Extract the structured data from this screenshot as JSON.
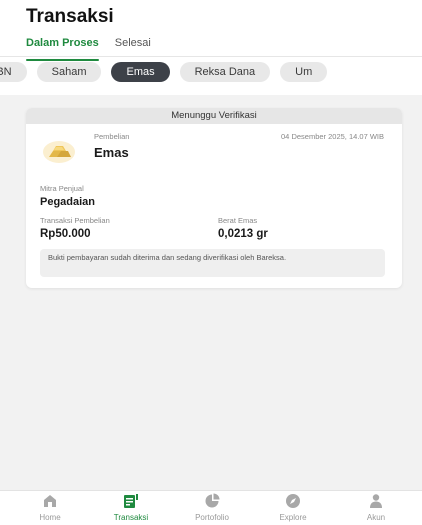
{
  "header": {
    "title": "Transaksi",
    "status_tabs": [
      {
        "label": "Dalam Proses",
        "active": true
      },
      {
        "label": "Selesai",
        "active": false
      }
    ],
    "category_chips": [
      {
        "label": "SBN",
        "active": false
      },
      {
        "label": "Saham",
        "active": false
      },
      {
        "label": "Emas",
        "active": true
      },
      {
        "label": "Reksa Dana",
        "active": false
      },
      {
        "label": "Um",
        "active": false
      }
    ]
  },
  "card": {
    "status": "Menunggu Verifikasi",
    "icon": "gold-bar-icon",
    "type": "Pembelian",
    "product": "Emas",
    "date": "04 Desember 2025, 14.07 WIB",
    "seller_label": "Mitra Penjual",
    "seller_value": "Pegadaian",
    "amount_label": "Transaksi Pembelian",
    "amount_value": "Rp50.000",
    "weight_label": "Berat Emas",
    "weight_value": "0,0213 gr",
    "note": "Bukti pembayaran sudah diterima dan sedang diverifikasi oleh Bareksa."
  },
  "bottom_nav": [
    {
      "label": "Home",
      "icon": "home-icon",
      "active": false
    },
    {
      "label": "Transaksi",
      "icon": "transaction-icon",
      "active": true
    },
    {
      "label": "Portofolio",
      "icon": "pie-chart-icon",
      "active": false
    },
    {
      "label": "Explore",
      "icon": "compass-icon",
      "active": false
    },
    {
      "label": "Akun",
      "icon": "user-icon",
      "active": false
    }
  ],
  "colors": {
    "accent": "#1f8a3f",
    "chip_active": "#3d4148",
    "gold": "#e3b84a"
  }
}
